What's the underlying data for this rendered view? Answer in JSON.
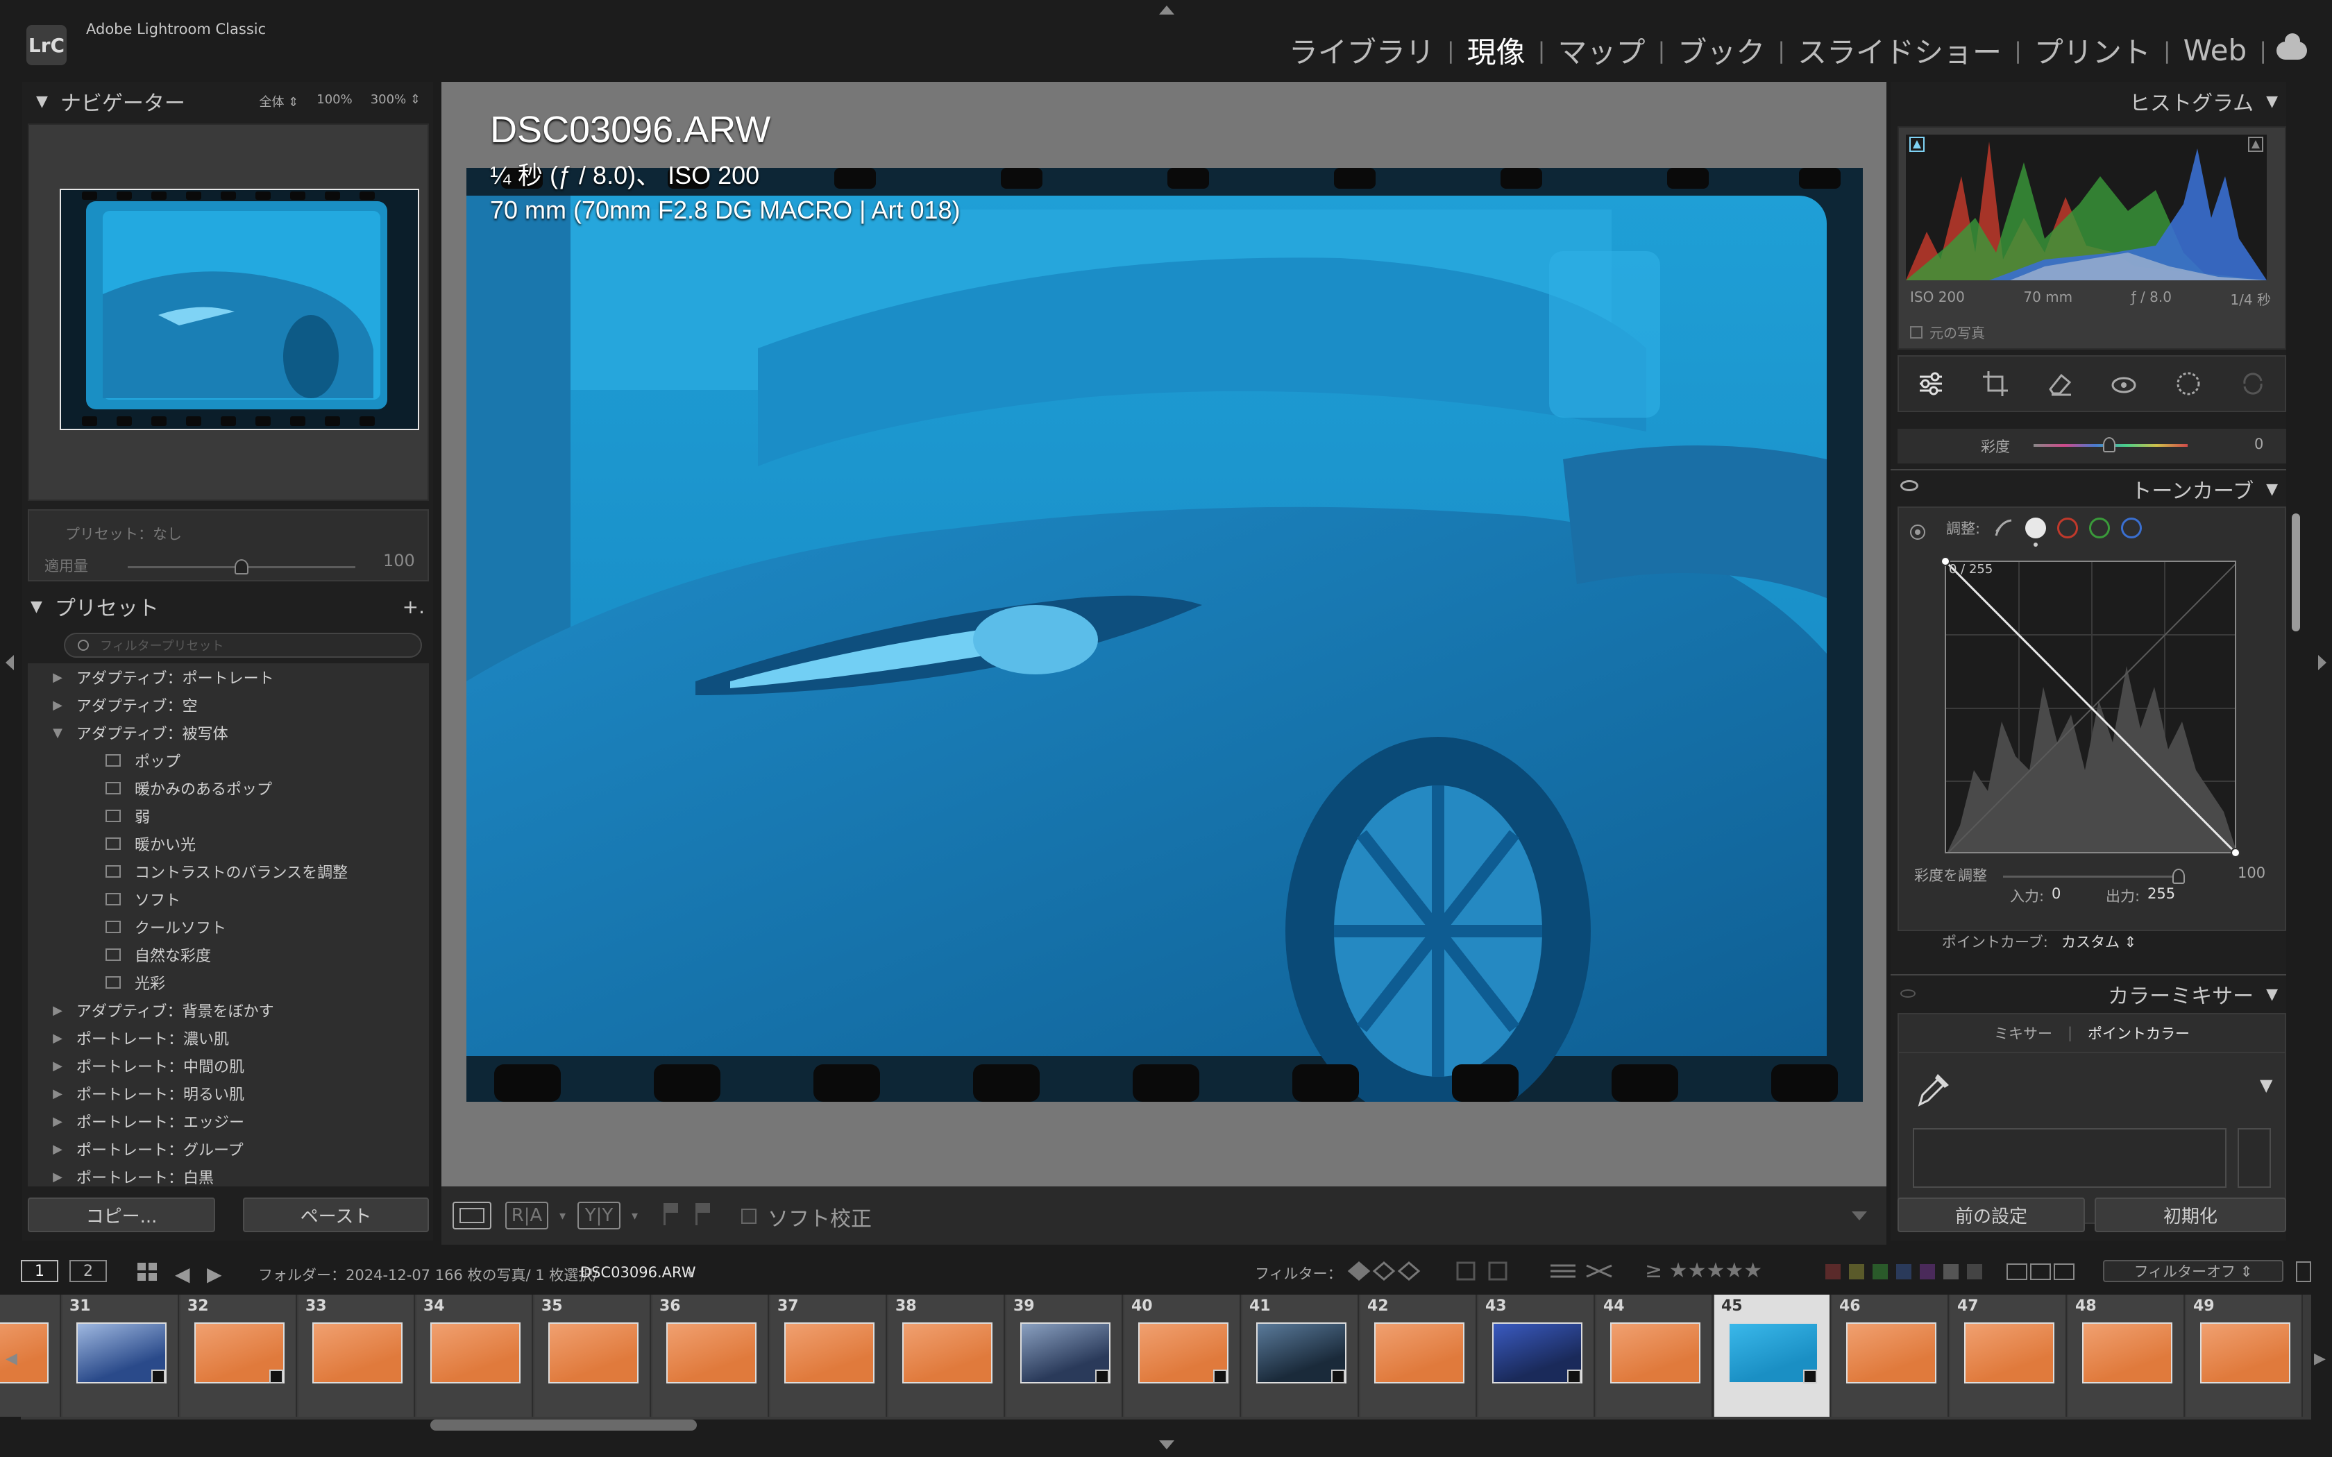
{
  "app": {
    "logo": "LrC",
    "name": "Adobe Lightroom Classic"
  },
  "modules": [
    "ライブラリ",
    "現像",
    "マップ",
    "ブック",
    "スライドショー",
    "プリント",
    "Web"
  ],
  "active_module": "現像",
  "navigator": {
    "title": "ナビゲーター",
    "zoom_fit": "全体 ⇕",
    "zoom_100": "100%",
    "zoom_300": "300% ⇕"
  },
  "preset_amount": {
    "label": "プリセット：なし",
    "amount_label": "適用量",
    "amount_value": "100",
    "amount_level": 0.5
  },
  "presets": {
    "title": "プリセット",
    "add": "+.",
    "search_placeholder": "フィルタープリセット",
    "items": [
      {
        "label": "アダプティブ：ポートレート",
        "type": "group",
        "open": false
      },
      {
        "label": "アダプティブ：空",
        "type": "group",
        "open": false
      },
      {
        "label": "アダプティブ：被写体",
        "type": "group",
        "open": true
      },
      {
        "label": "ポップ",
        "type": "child"
      },
      {
        "label": "暖かみのあるポップ",
        "type": "child"
      },
      {
        "label": "弱",
        "type": "child"
      },
      {
        "label": "暖かい光",
        "type": "child"
      },
      {
        "label": "コントラストのバランスを調整",
        "type": "child"
      },
      {
        "label": "ソフト",
        "type": "child"
      },
      {
        "label": "クールソフト",
        "type": "child"
      },
      {
        "label": "自然な彩度",
        "type": "child"
      },
      {
        "label": "光彩",
        "type": "child"
      },
      {
        "label": "アダプティブ：背景をぼかす",
        "type": "group",
        "open": false
      },
      {
        "label": "ポートレート：濃い肌",
        "type": "group",
        "open": false
      },
      {
        "label": "ポートレート：中間の肌",
        "type": "group",
        "open": false
      },
      {
        "label": "ポートレート：明るい肌",
        "type": "group",
        "open": false
      },
      {
        "label": "ポートレート：エッジー",
        "type": "group",
        "open": false
      },
      {
        "label": "ポートレート：グループ",
        "type": "group",
        "open": false
      },
      {
        "label": "ポートレート：白黒",
        "type": "group",
        "open": false
      }
    ]
  },
  "left_buttons": {
    "copy": "コピー...",
    "paste": "ペースト"
  },
  "photo": {
    "filename": "DSC03096.ARW",
    "exposure": "¼ 秒 (ƒ / 8.0)、 ISO 200",
    "lens": "70 mm (70mm F2.8 DG MACRO | Art 018)"
  },
  "toolbar": {
    "ra": "R|A",
    "yy": "Y|Y",
    "soft_proof": "ソフト校正"
  },
  "histogram": {
    "title": "ヒストグラム",
    "iso": "ISO 200",
    "focal": "70 mm",
    "aperture": "ƒ / 8.0",
    "shutter": "1/4 秒",
    "original": "元の写真"
  },
  "saturation": {
    "label": "彩度",
    "value": "0"
  },
  "tone_curve": {
    "title": "トーンカーブ",
    "adjust_label": "調整:",
    "point_readout": "0 / 255",
    "sat_adjust_label": "彩度を調整",
    "sat_adjust_value": "100",
    "input_label": "入力:",
    "input_value": "0",
    "output_label": "出力:",
    "output_value": "255",
    "point_curve_label": "ポイントカーブ:",
    "point_curve_value": "カスタム ⇕"
  },
  "color_mixer": {
    "title": "カラーミキサー",
    "tab_mixer": "ミキサー",
    "tab_point_color": "ポイントカラー"
  },
  "right_buttons": {
    "previous": "前の設定",
    "reset": "初期化"
  },
  "filmstrip_bar": {
    "page1": "1",
    "page2": "2",
    "folder_info": "フォルダー：2024-12-07  166 枚の写真/ 1 枚選択/",
    "selected_file": "DSC03096.ARW",
    "filter_label": "フィルター：",
    "stars": "≥ ★★★★★",
    "filter_off": "フィルターオフ ⇕"
  },
  "filmstrip": [
    {
      "num": "",
      "tone": "orange"
    },
    {
      "num": "31",
      "tone": "city"
    },
    {
      "num": "32",
      "tone": "orange"
    },
    {
      "num": "33",
      "tone": "orange"
    },
    {
      "num": "34",
      "tone": "orange"
    },
    {
      "num": "35",
      "tone": "orange"
    },
    {
      "num": "36",
      "tone": "orange"
    },
    {
      "num": "37",
      "tone": "orange"
    },
    {
      "num": "38",
      "tone": "orange"
    },
    {
      "num": "39",
      "tone": "building"
    },
    {
      "num": "40",
      "tone": "orange"
    },
    {
      "num": "41",
      "tone": "car-dark"
    },
    {
      "num": "42",
      "tone": "orange"
    },
    {
      "num": "43",
      "tone": "car-blue"
    },
    {
      "num": "44",
      "tone": "orange"
    },
    {
      "num": "45",
      "tone": "blue",
      "selected": true
    },
    {
      "num": "46",
      "tone": "orange"
    },
    {
      "num": "47",
      "tone": "orange"
    },
    {
      "num": "48",
      "tone": "orange"
    },
    {
      "num": "49",
      "tone": "orange"
    }
  ],
  "colors": {
    "accent_blue": "#1aa9de",
    "film_orange": "#e07a3c",
    "histogram_red": "#c0392b",
    "histogram_green": "#3a9a3a",
    "histogram_blue": "#3a6fd0"
  }
}
